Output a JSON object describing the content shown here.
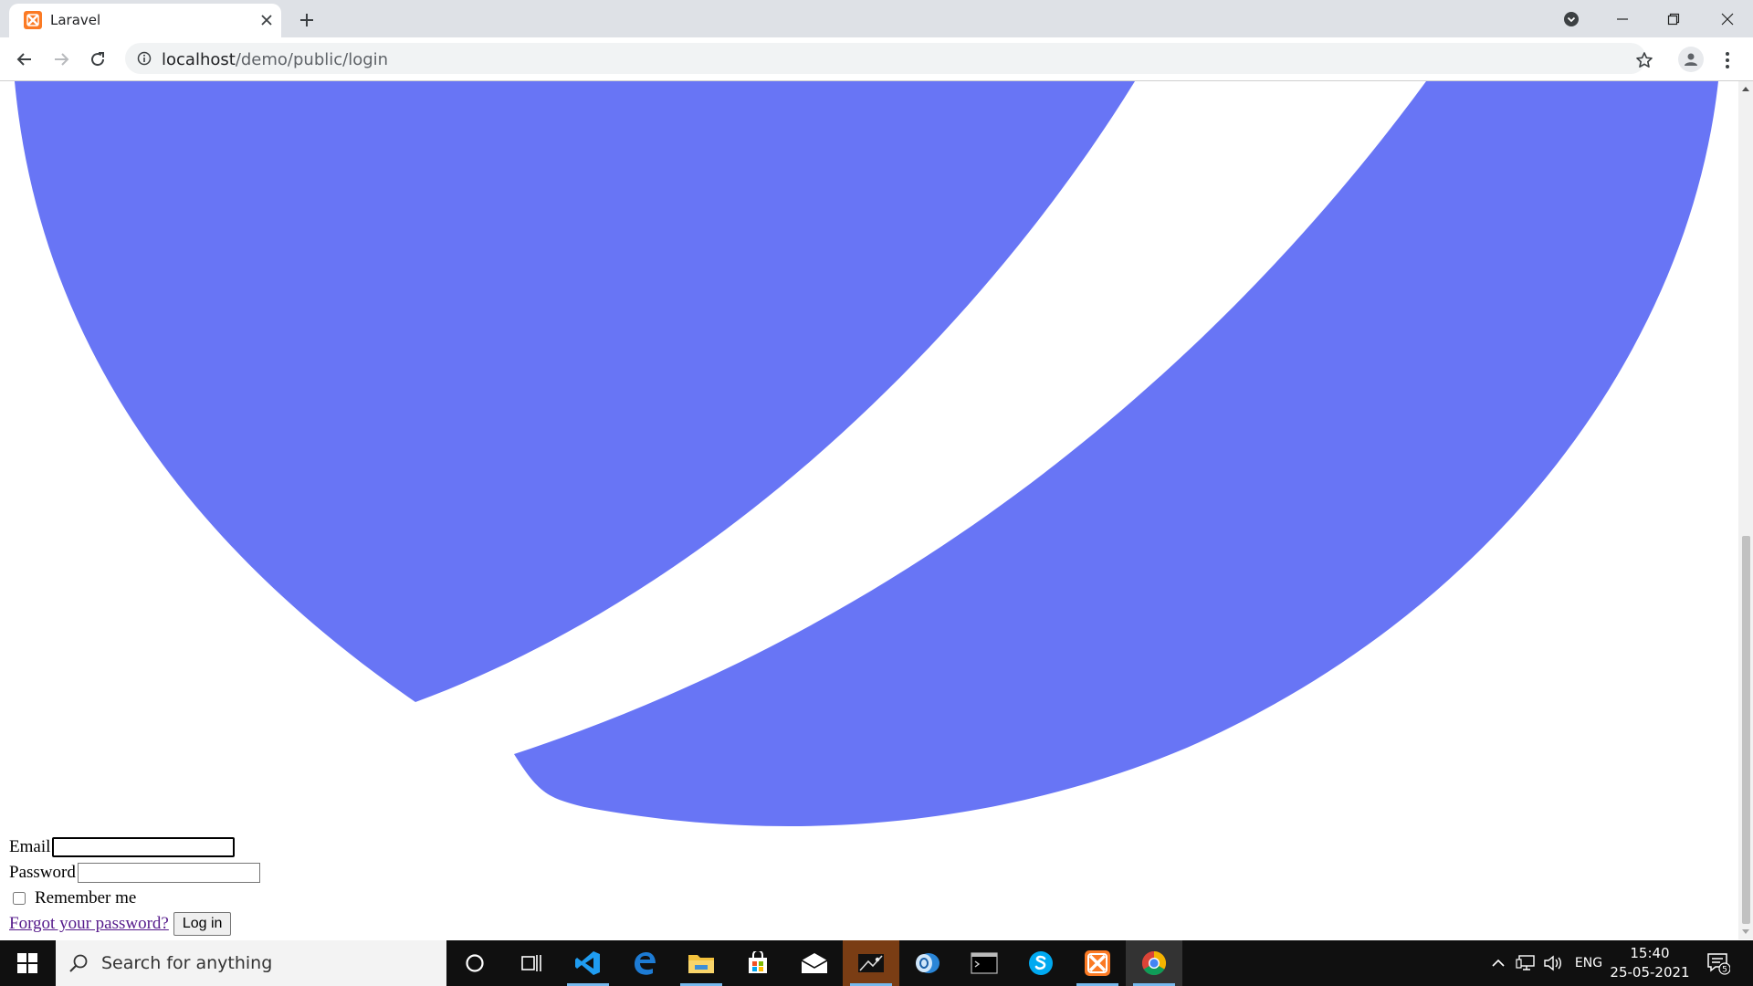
{
  "browser": {
    "tab_title": "Laravel",
    "url_host": "localhost",
    "url_path": "/demo/public/login"
  },
  "form": {
    "email_label": "Email",
    "password_label": "Password",
    "remember_label": "Remember me",
    "forgot_link": "Forgot your password?",
    "login_button": "Log in"
  },
  "logo": {
    "color": "#6875f5"
  },
  "taskbar": {
    "search_placeholder": "Search for anything",
    "apps": [
      "cortana-icon",
      "task-view-icon",
      "vscode-icon",
      "edge-icon",
      "file-explorer-icon",
      "store-icon",
      "mail-icon",
      "media-app-icon",
      "outlook-icon",
      "terminal-icon",
      "skype-icon",
      "xampp-icon",
      "chrome-icon"
    ],
    "language": "ENG",
    "time": "15:40",
    "date": "25-05-2021",
    "notification_count": "5"
  }
}
